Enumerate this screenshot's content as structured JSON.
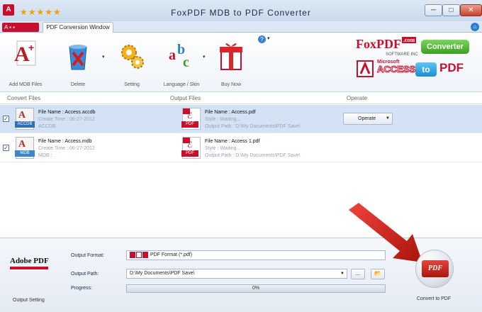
{
  "window": {
    "title": "FoxPDF MDB to PDF Converter",
    "rating_stars": "★★★★★",
    "minimize": "─",
    "maximize": "□",
    "close": "✕"
  },
  "tabs": {
    "quick_access": "A ▪ ▪",
    "active_tab": "PDF Conversion Window"
  },
  "ribbon": {
    "buttons": [
      {
        "label": "Add MDB Files",
        "icon": "add-files-icon"
      },
      {
        "label": "Delete",
        "icon": "recycle-bin-icon"
      },
      {
        "label": "Setting",
        "icon": "gears-icon"
      },
      {
        "label": "Language / Skin",
        "icon": "abc-icon"
      },
      {
        "label": "Buy Now",
        "icon": "gift-icon"
      }
    ],
    "help": "?",
    "brand": {
      "foxpdf": "FoxPDF",
      "com": ".com",
      "software": "SOFTWARE INC",
      "converter": "Converter",
      "microsoft": "Microsoft",
      "access": "ACCESS",
      "to": "to",
      "pdf": "PDF"
    }
  },
  "list": {
    "headers": {
      "convert_files": "Convert Files",
      "output_files": "Output Files",
      "operate": "Operate"
    },
    "rows": [
      {
        "checked": "✓",
        "file_type": "ACCDB",
        "file_name": "File Name : Access.accdb",
        "create_time": "Create Time : 06-27-2012",
        "type_line": "ACCDB",
        "out_name": "File Name : Access.pdf",
        "out_style": "Style : Waiting...",
        "out_path": "Output Path : D:\\My Documents\\PDF Save\\",
        "operate": "Operate"
      },
      {
        "checked": "✓",
        "file_type": "MDB",
        "file_name": "File Name : Access.mdb",
        "create_time": "Create Time : 06-27-2012",
        "type_line": "MDB :",
        "out_name": "File Name : Access 1.pdf",
        "out_style": "Style : Waiting...",
        "out_path": "Output Path : D:\\My Documents\\PDF Save\\"
      }
    ]
  },
  "output": {
    "section_label": "Output Setting",
    "adobe_logo": "Adobe PDF",
    "format_label": "Output Format:",
    "format_value": "PDF Format (*.pdf)",
    "path_label": "Output Path:",
    "path_value": "D:\\My Documents\\PDF Save\\",
    "browse": "...",
    "open_folder": "📂",
    "progress_label": "Progress:",
    "progress_percent": 0,
    "progress_text": "0%",
    "convert_label": "Convert to PDF",
    "convert_icon_text": "PDF"
  },
  "colors": {
    "accent_red": "#c8102e",
    "selection": "#d3e2f4",
    "converter_green": "#3d9e22"
  }
}
